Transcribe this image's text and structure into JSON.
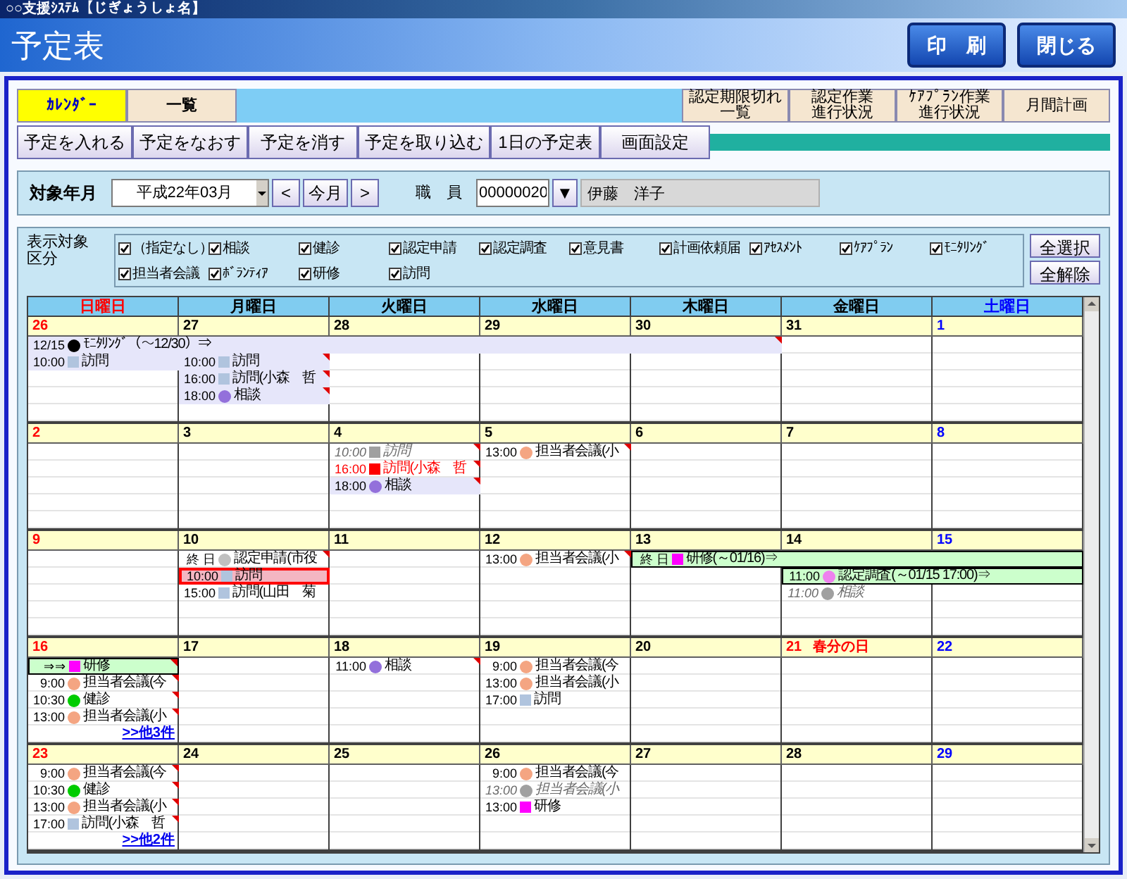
{
  "window": {
    "title": "○○支援ｼｽﾃﾑ【じぎょうしょ名】"
  },
  "header": {
    "title": "予定表",
    "buttons": [
      "印　刷",
      "閉じる"
    ]
  },
  "tabs": [
    {
      "label": "ｶﾚﾝﾀﾞｰ",
      "selected": true
    },
    {
      "label": "一覧",
      "selected": false
    }
  ],
  "report_buttons": [
    [
      "認定期限切れ",
      "一覧"
    ],
    [
      "認定作業",
      "進行状況"
    ],
    [
      "ｹｱﾌﾟﾗﾝ作業",
      "進行状況"
    ],
    [
      "月間計画"
    ]
  ],
  "actions": [
    "予定を入れる",
    "予定をなおす",
    "予定を消す",
    "予定を取り込む",
    "1日の予定表",
    "画面設定"
  ],
  "filter": {
    "month_label": "対象年月",
    "month": "平成22年03月",
    "prev": "<",
    "today": "今月",
    "next": ">",
    "staff_label": "職　員",
    "staff_code": "00000020",
    "staff_button": "▼",
    "staff_name": "伊藤　洋子"
  },
  "categories": {
    "label": [
      "表示対象",
      "区分"
    ],
    "items": [
      {
        "label": "（指定なし）",
        "checked": true
      },
      {
        "label": "相談",
        "checked": true
      },
      {
        "label": "健診",
        "checked": true
      },
      {
        "label": "認定申請",
        "checked": true
      },
      {
        "label": "認定調査",
        "checked": true
      },
      {
        "label": "意見書",
        "checked": true
      },
      {
        "label": "計画依頼届",
        "checked": true
      },
      {
        "label": "ｱｾｽﾒﾝﾄ",
        "checked": true
      },
      {
        "label": "ｹｱﾌﾟﾗﾝ",
        "checked": true
      },
      {
        "label": "ﾓﾆﾀﾘﾝｸﾞ",
        "checked": true
      },
      {
        "label": "担当者会議",
        "checked": true
      },
      {
        "label": "ﾎﾞﾗﾝﾃｨｱ",
        "checked": true
      },
      {
        "label": "研修",
        "checked": true
      },
      {
        "label": "訪問",
        "checked": true
      }
    ],
    "select_all": "全選択",
    "clear_all": "全解除"
  },
  "calendar": {
    "weekdays": [
      "日曜日",
      "月曜日",
      "火曜日",
      "水曜日",
      "木曜日",
      "金曜日",
      "土曜日"
    ],
    "weeks": [
      {
        "days": [
          {
            "date": "26",
            "lanes": [
              {
                "kind": "shaded",
                "time": "12/15",
                "marker": {
                  "kind": "round",
                  "color": "#000000"
                },
                "label": "ﾓﾆﾀﾘﾝｸﾞ（～12/30）⇒",
                "selected": false,
                "corner": true
              },
              {
                "kind": "shaded",
                "time": "10:00",
                "marker": {
                  "kind": "square",
                  "color": "#b0c4de"
                },
                "label": "訪問",
                "selected": false,
                "corner": false
              }
            ]
          },
          {
            "date": "27",
            "lanes": [
              {
                "kind": "continued"
              },
              {
                "kind": "shaded",
                "time": "10:00",
                "marker": {
                  "kind": "square",
                  "color": "#b0c4de"
                },
                "label": "訪問",
                "selected": false,
                "corner": true
              },
              {
                "kind": "shaded",
                "time": "16:00",
                "marker": {
                  "kind": "square",
                  "color": "#b0c4de"
                },
                "label": "訪問(小森　哲",
                "selected": false,
                "corner": true
              },
              {
                "kind": "shaded",
                "time": "18:00",
                "marker": {
                  "kind": "round",
                  "color": "#9370db"
                },
                "label": "相談",
                "selected": false,
                "corner": true
              }
            ]
          },
          {
            "date": "28",
            "lanes": [
              {
                "kind": "continued"
              }
            ]
          },
          {
            "date": "29",
            "lanes": [
              {
                "kind": "continued"
              }
            ]
          },
          {
            "date": "30",
            "lanes": [
              {
                "kind": "continued"
              }
            ]
          },
          {
            "date": "31"
          },
          {
            "date": "1"
          }
        ]
      },
      {
        "days": [
          {
            "date": "2"
          },
          {
            "date": "3"
          },
          {
            "date": "4",
            "lanes": [
              {
                "kind": "cancelled",
                "time": "10:00",
                "marker": {
                  "kind": "square",
                  "color": "#a0a0a0"
                },
                "label": "訪問",
                "selected": false,
                "corner": true
              },
              {
                "kind": "urgent",
                "time": "16:00",
                "marker": {
                  "kind": "square",
                  "color": "#ff0000"
                },
                "label": "訪問(小森　哲",
                "selected": false,
                "corner": true
              },
              {
                "kind": "shaded",
                "time": "18:00",
                "marker": {
                  "kind": "round",
                  "color": "#9370db"
                },
                "label": "相談",
                "selected": false,
                "corner": true
              }
            ]
          },
          {
            "date": "5",
            "lanes": [
              {
                "kind": "plain",
                "time": "13:00",
                "marker": {
                  "kind": "round",
                  "color": "#f4a582"
                },
                "label": "担当者会議(小",
                "selected": false,
                "corner": true
              }
            ]
          },
          {
            "date": "6"
          },
          {
            "date": "7"
          },
          {
            "date": "8"
          }
        ]
      },
      {
        "days": [
          {
            "date": "9"
          },
          {
            "date": "10",
            "lanes": [
              {
                "kind": "plain",
                "time": "終 日",
                "marker": {
                  "kind": "round",
                  "color": "#c0c0c0"
                },
                "label": "認定申請(市役",
                "selected": false,
                "corner": true
              },
              {
                "kind": "plain",
                "time": "10:00",
                "marker": {
                  "kind": "square",
                  "color": "#b0c4de"
                },
                "label": "訪問",
                "selected": true,
                "corner": false
              },
              {
                "kind": "plain",
                "time": "15:00",
                "marker": {
                  "kind": "square",
                  "color": "#b0c4de"
                },
                "label": "訪問(山田　菊",
                "selected": false,
                "corner": false
              }
            ]
          },
          {
            "date": "11"
          },
          {
            "date": "12",
            "lanes": [
              {
                "kind": "plain",
                "time": "13:00",
                "marker": {
                  "kind": "round",
                  "color": "#f4a582"
                },
                "label": "担当者会議(小",
                "selected": false,
                "corner": true
              }
            ]
          },
          {
            "date": "13",
            "lanes": [
              {
                "kind": "boxed",
                "time": "終 日",
                "marker": {
                  "kind": "square",
                  "color": "#ff00ff"
                },
                "label": "研修(～01/16)⇒",
                "selected": false,
                "corner": false
              }
            ]
          },
          {
            "date": "14",
            "lanes": [
              {
                "kind": "continued"
              },
              {
                "kind": "boxed",
                "time": "11:00",
                "marker": {
                  "kind": "round",
                  "color": "#ee82ee"
                },
                "label": "認定調査(～01/15 17:00)⇒",
                "selected": false,
                "corner": false
              },
              {
                "kind": "cancelled",
                "time": "11:00",
                "marker": {
                  "kind": "round",
                  "color": "#a0a0a0"
                },
                "label": "相談",
                "selected": false,
                "corner": false
              }
            ]
          },
          {
            "date": "15",
            "lanes": [
              {
                "kind": "continued"
              },
              {
                "kind": "continued"
              }
            ]
          }
        ]
      },
      {
        "days": [
          {
            "date": "16",
            "lanes": [
              {
                "kind": "boxed",
                "time": "⇒⇒",
                "marker": {
                  "kind": "square",
                  "color": "#ff00ff"
                },
                "label": "研修",
                "selected": false,
                "corner": true
              },
              {
                "kind": "plain",
                "time": "9:00",
                "marker": {
                  "kind": "round",
                  "color": "#f4a582"
                },
                "label": "担当者会議(今",
                "selected": false,
                "corner": true
              },
              {
                "kind": "plain",
                "time": "10:30",
                "marker": {
                  "kind": "round",
                  "color": "#00cc00"
                },
                "label": "健診",
                "selected": false,
                "corner": true
              },
              {
                "kind": "plain",
                "time": "13:00",
                "marker": {
                  "kind": "round",
                  "color": "#f4a582"
                },
                "label": "担当者会議(小",
                "selected": false,
                "corner": true
              }
            ],
            "more": ">>他3件"
          },
          {
            "date": "17"
          },
          {
            "date": "18",
            "lanes": [
              {
                "kind": "plain",
                "time": "11:00",
                "marker": {
                  "kind": "round",
                  "color": "#9370db"
                },
                "label": "相談",
                "selected": false,
                "corner": true
              }
            ]
          },
          {
            "date": "19",
            "lanes": [
              {
                "kind": "plain",
                "time": "9:00",
                "marker": {
                  "kind": "round",
                  "color": "#f4a582"
                },
                "label": "担当者会議(今",
                "selected": false,
                "corner": false
              },
              {
                "kind": "plain",
                "time": "13:00",
                "marker": {
                  "kind": "round",
                  "color": "#f4a582"
                },
                "label": "担当者会議(小",
                "selected": false,
                "corner": false
              },
              {
                "kind": "plain",
                "time": "17:00",
                "marker": {
                  "kind": "square",
                  "color": "#b0c4de"
                },
                "label": "訪問",
                "selected": false,
                "corner": false
              }
            ]
          },
          {
            "date": "20"
          },
          {
            "date": "21",
            "holiday": "春分の日"
          },
          {
            "date": "22"
          }
        ]
      },
      {
        "days": [
          {
            "date": "23",
            "lanes": [
              {
                "kind": "plain",
                "time": "9:00",
                "marker": {
                  "kind": "round",
                  "color": "#f4a582"
                },
                "label": "担当者会議(今",
                "selected": false,
                "corner": true
              },
              {
                "kind": "plain",
                "time": "10:30",
                "marker": {
                  "kind": "round",
                  "color": "#00cc00"
                },
                "label": "健診",
                "selected": false,
                "corner": true
              },
              {
                "kind": "plain",
                "time": "13:00",
                "marker": {
                  "kind": "round",
                  "color": "#f4a582"
                },
                "label": "担当者会議(小",
                "selected": false,
                "corner": true
              },
              {
                "kind": "plain",
                "time": "17:00",
                "marker": {
                  "kind": "square",
                  "color": "#b0c4de"
                },
                "label": "訪問(小森　哲",
                "selected": false,
                "corner": true
              }
            ],
            "more": ">>他2件"
          },
          {
            "date": "24"
          },
          {
            "date": "25"
          },
          {
            "date": "26",
            "lanes": [
              {
                "kind": "plain",
                "time": "9:00",
                "marker": {
                  "kind": "round",
                  "color": "#f4a582"
                },
                "label": "担当者会議(今",
                "selected": false,
                "corner": false
              },
              {
                "kind": "cancelled",
                "time": "13:00",
                "marker": {
                  "kind": "round",
                  "color": "#a0a0a0"
                },
                "label": "担当者会議(小",
                "selected": false,
                "corner": false
              },
              {
                "kind": "plain",
                "time": "13:00",
                "marker": {
                  "kind": "square",
                  "color": "#ff00ff"
                },
                "label": "研修",
                "selected": false,
                "corner": false
              }
            ]
          },
          {
            "date": "27"
          },
          {
            "date": "28"
          },
          {
            "date": "29"
          }
        ]
      }
    ]
  }
}
